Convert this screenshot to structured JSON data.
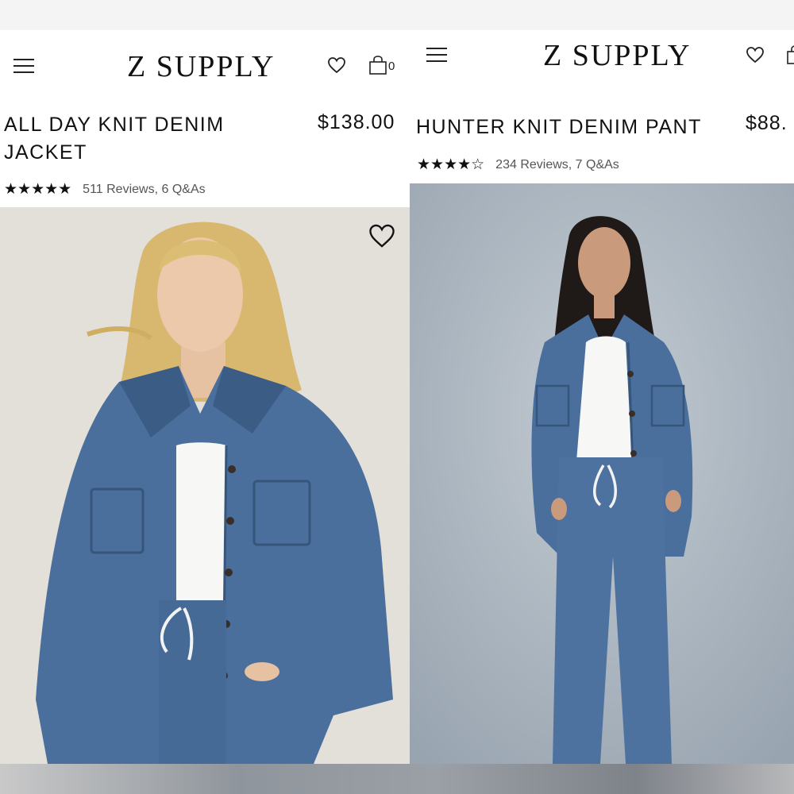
{
  "left": {
    "brand": "Z SUPPLY",
    "cart_count": "0",
    "product": {
      "title_line1": "ALL DAY KNIT DENIM",
      "title_line2": "JACKET",
      "price": "$138.00",
      "rating": 5,
      "stars": "★★★★★",
      "reviews": "511 Reviews, 6 Q&As"
    }
  },
  "right": {
    "brand": "Z SUPPLY",
    "product": {
      "title": "HUNTER KNIT DENIM PANT",
      "price": "$88.",
      "rating": 4.5,
      "stars": "★★★★☆",
      "reviews": "234 Reviews, 7 Q&As"
    }
  },
  "colors": {
    "denim": "#4a6f9c",
    "denim_dark": "#3b5c85",
    "left_backdrop": "#e7e3dd",
    "right_backdrop": "#aab4bd",
    "tee": "#f7f7f5"
  }
}
